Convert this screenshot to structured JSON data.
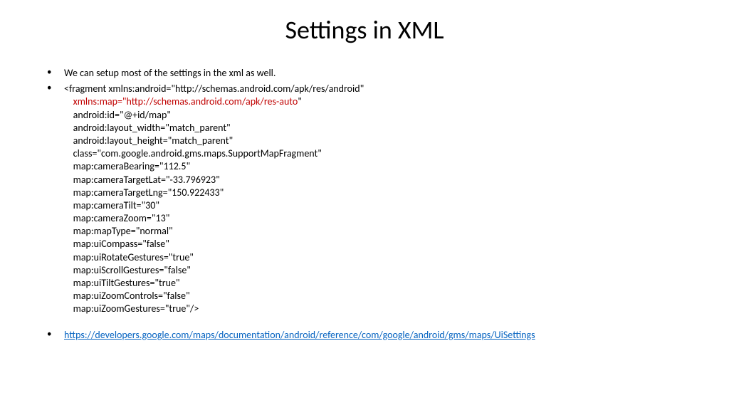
{
  "title": "Settings in XML",
  "bullets": {
    "intro": "We can setup most of the settings in the xml as well.",
    "code_line1": "<fragment xmlns:android=\"http://schemas.android.com/apk/res/android\"",
    "code_highlight": "xmlns:map=\"http://schemas.android.com/apk/res-auto",
    "code_highlight_end": "\"",
    "code_rest": "    android:id=\"@+id/map\"\n    android:layout_width=\"match_parent\"\n    android:layout_height=\"match_parent\"\n    class=\"com.google.android.gms.maps.SupportMapFragment\"\n    map:cameraBearing=\"112.5\"\n    map:cameraTargetLat=\"-33.796923\"\n    map:cameraTargetLng=\"150.922433\"\n    map:cameraTilt=\"30\"\n    map:cameraZoom=\"13\"\n    map:mapType=\"normal\"\n    map:uiCompass=\"false\"\n    map:uiRotateGestures=\"true\"\n    map:uiScrollGestures=\"false\"\n    map:uiTiltGestures=\"true\"\n    map:uiZoomControls=\"false\"\n    map:uiZoomGestures=\"true\"/>",
    "link": "https://developers.google.com/maps/documentation/android/reference/com/google/android/gms/maps/UiSettings"
  }
}
